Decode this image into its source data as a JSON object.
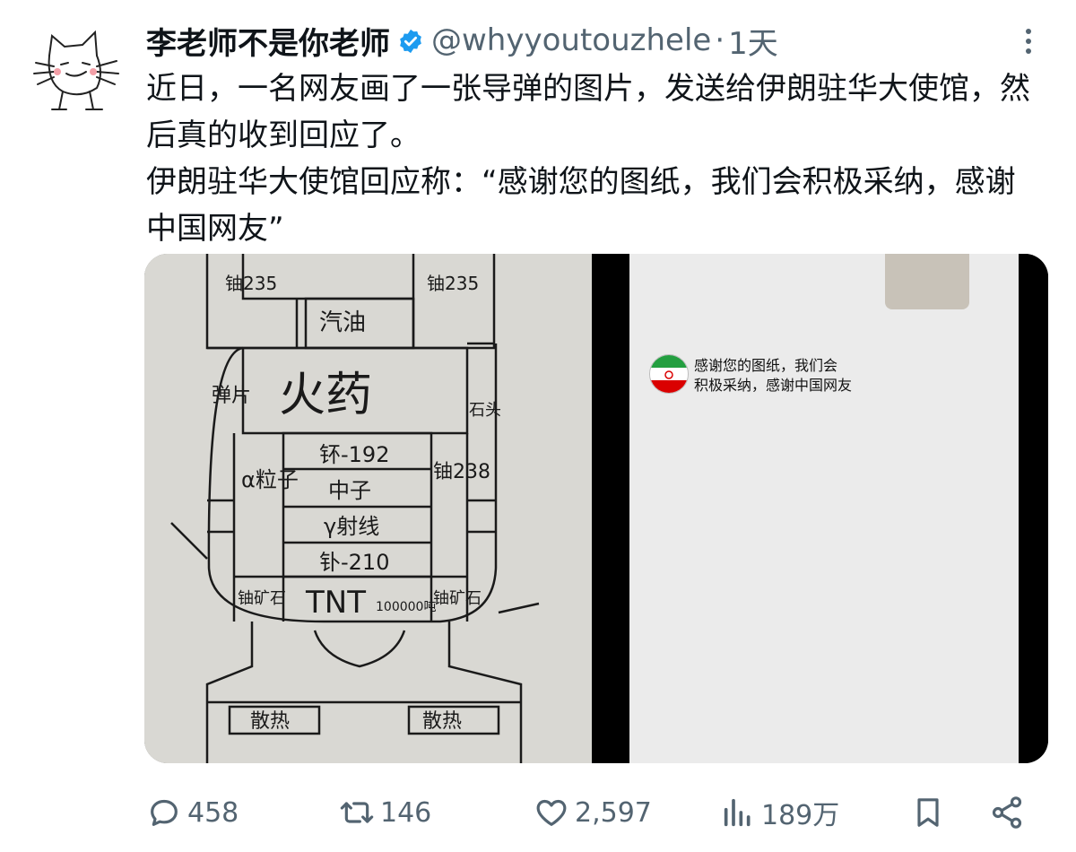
{
  "user": {
    "display_name": "李老师不是你老师",
    "handle": "@whyyoutouzhele",
    "separator": "·",
    "time": "1天",
    "verified": true
  },
  "tweet": {
    "paragraphs": [
      "近日，一名网友画了一张导弹的图片，发送给伊朗驻华大使馆，然后真的收到回应了。",
      "伊朗驻华大使馆回应称：“感谢您的图纸，我们会积极采纳，感谢中国网友”"
    ]
  },
  "media": {
    "drawing_labels": {
      "u235_left": "铀235",
      "u235_right": "铀235",
      "gasoline": "汽油",
      "gunpowder": "火药",
      "shrapnel": "弹片",
      "alpha": "α粒子",
      "pu": "钚-192",
      "neutron": "中子",
      "gamma": "γ射线",
      "po": "钋-210",
      "u238": "铀238",
      "stone": "石头",
      "tnt": "TNT",
      "tnt_amount": "100000吨",
      "ore_left": "铀矿石",
      "ore_right": "铀矿石",
      "cool_left": "散热",
      "cool_right": "散热"
    },
    "reply_text_line1": "感谢您的图纸，我们会",
    "reply_text_line2": "积极采纳，感谢中国网友"
  },
  "actions": {
    "replies": "458",
    "retweets": "146",
    "likes": "2,597",
    "views": "189万"
  },
  "colors": {
    "text": "#0f1419",
    "secondary": "#536471",
    "verified_blue": "#1d9bf0"
  }
}
